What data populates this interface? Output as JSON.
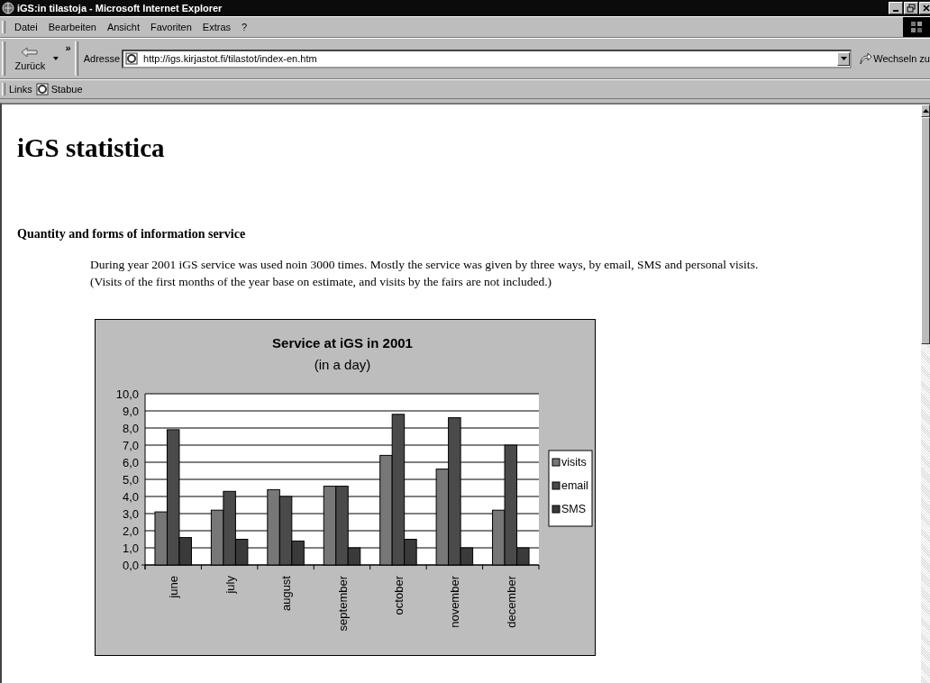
{
  "window": {
    "title": "iGS:in tilastoja - Microsoft Internet Explorer"
  },
  "menu": [
    "Datei",
    "Bearbeiten",
    "Ansicht",
    "Favoriten",
    "Extras",
    "?"
  ],
  "toolbar": {
    "back_label": "Zurück",
    "chevron": "»"
  },
  "address": {
    "label": "Adresse",
    "value": "http://igs.kirjastot.fi/tilastot/index-en.htm",
    "go_label": "Wechseln zu"
  },
  "links_bar": {
    "label": "Links",
    "items": [
      "Stabue"
    ]
  },
  "page": {
    "heading": "iGS statistica",
    "subheading": "Quantity and forms of information service",
    "paragraph_lines": [
      "During year 2001 iGS service was used noin 3000 times. Mostly the service was given by three ways, by email, SMS and personal visits.",
      "(Visits of the first months of the year base on estimate, and visits by the fairs are not included.)"
    ],
    "chart_data": {
      "type": "bar",
      "title": "Service at iGS in  2001",
      "subtitle": "(in a day)",
      "categories": [
        "june",
        "july",
        "august",
        "september",
        "october",
        "november",
        "december"
      ],
      "series": [
        {
          "name": "visits",
          "color": "#777777",
          "values": [
            3.1,
            3.2,
            4.4,
            4.6,
            6.4,
            5.6,
            3.2
          ]
        },
        {
          "name": "email",
          "color": "#4a4a4a",
          "values": [
            7.9,
            4.3,
            4.0,
            4.6,
            8.8,
            8.6,
            7.0
          ]
        },
        {
          "name": "SMS",
          "color": "#3a3a3a",
          "values": [
            1.6,
            1.5,
            1.4,
            1.0,
            1.5,
            1.0,
            1.0
          ]
        }
      ],
      "ylim": [
        0,
        10
      ],
      "grid": true,
      "legend": true,
      "yticks": [
        {
          "value": 0,
          "label": "0,0"
        },
        {
          "value": 1,
          "label": "1,0"
        },
        {
          "value": 2,
          "label": "2,0"
        },
        {
          "value": 3,
          "label": "3,0"
        },
        {
          "value": 4,
          "label": "4,0"
        },
        {
          "value": 5,
          "label": "5,0"
        },
        {
          "value": 6,
          "label": "6,0"
        },
        {
          "value": 7,
          "label": "7,0"
        },
        {
          "value": 8,
          "label": "8,0"
        },
        {
          "value": 9,
          "label": "9,0"
        },
        {
          "value": 10,
          "label": "10,0"
        }
      ]
    }
  }
}
